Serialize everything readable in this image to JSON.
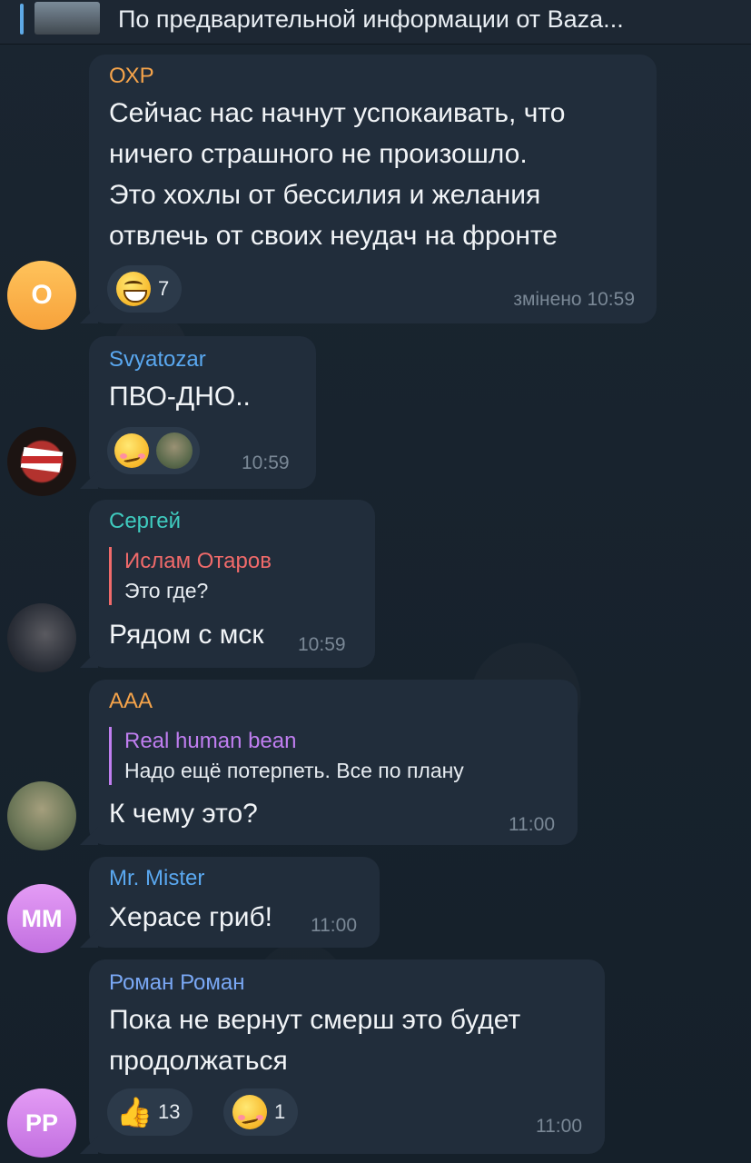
{
  "pinned": {
    "text": "По предварительной информации от Baza..."
  },
  "messages": [
    {
      "author": "ОХР",
      "author_color": "#f5a34a",
      "lines": [
        "Сейчас нас начнут успокаивать, что",
        "ничего страшного не произошло.",
        "Это хохлы от бессилия и желания",
        "отвлечь от своих неудач на фронте"
      ],
      "reactions": [
        {
          "icon": "grinning-face-icon",
          "count": "7"
        }
      ],
      "time": "змінено 10:59",
      "avatar": "О"
    },
    {
      "author": "Svyatozar",
      "author_color": "#5aa8f0",
      "lines": [
        "ПВО-ДНО.."
      ],
      "reactions": [
        {
          "icon": "woozy-face-icon"
        },
        {
          "icon": "user-photo-reaction"
        }
      ],
      "time": "10:59"
    },
    {
      "author": "Сергей",
      "author_color": "#3fcbbf",
      "reply": {
        "author": "Ислам Отаров",
        "text": "Это где?",
        "color": "#f06a6a"
      },
      "lines": [
        "Рядом с мск"
      ],
      "time": "10:59"
    },
    {
      "author": "AAA",
      "author_color": "#f5a34a",
      "reply": {
        "author": "Real human bean",
        "text": "Надо ещё потерпеть. Все по плану",
        "color": "#c07ef0"
      },
      "lines": [
        "К чему это?"
      ],
      "time": "11:00"
    },
    {
      "author": "Mr. Mister",
      "author_color": "#5aa8f0",
      "lines": [
        "Херасе гриб!"
      ],
      "time": "11:00",
      "avatar": "MM"
    },
    {
      "author": "Роман Роман",
      "author_color": "#7aa8f5",
      "lines": [
        "Пока не вернут смерш это будет",
        "продолжаться"
      ],
      "reactions": [
        {
          "icon": "thumbs-up-icon",
          "count": "13"
        },
        {
          "icon": "woozy-face-icon",
          "count": "1"
        }
      ],
      "time": "11:00",
      "avatar": "PP"
    }
  ]
}
